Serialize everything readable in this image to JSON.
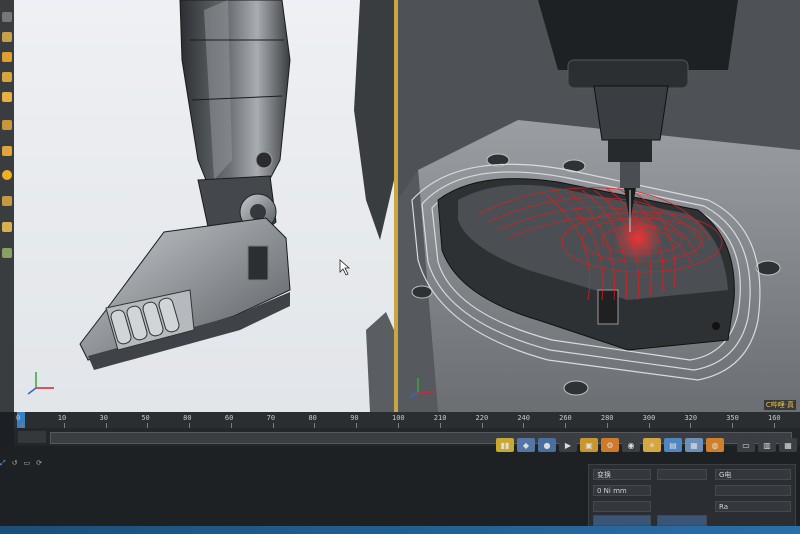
{
  "viewport_left": {
    "label": ""
  },
  "viewport_right": {
    "label": "",
    "watermark": "C哔哩·真"
  },
  "timeline": {
    "ticks": [
      "0",
      "10",
      "30",
      "50",
      "80",
      "60",
      "70",
      "80",
      "90",
      "100",
      "210",
      "220",
      "240",
      "260",
      "280",
      "300",
      "320",
      "350",
      "160"
    ],
    "frame_value": ""
  },
  "bottom": {
    "attributes": {
      "row1_left": "变换",
      "row1_right": "G电",
      "row2_left": "0 Ni mm",
      "row2_right": "",
      "row3_left": "",
      "row3_right": "Ra"
    }
  },
  "colors": {
    "toolpath": "#e21c1c",
    "accent": "#c8a641",
    "playhead": "#3c7fc0"
  },
  "icons": [
    "axis-gizmo-icon",
    "cursor-icon",
    "play-icon",
    "record-icon",
    "keyframe-icon",
    "render-icon"
  ]
}
